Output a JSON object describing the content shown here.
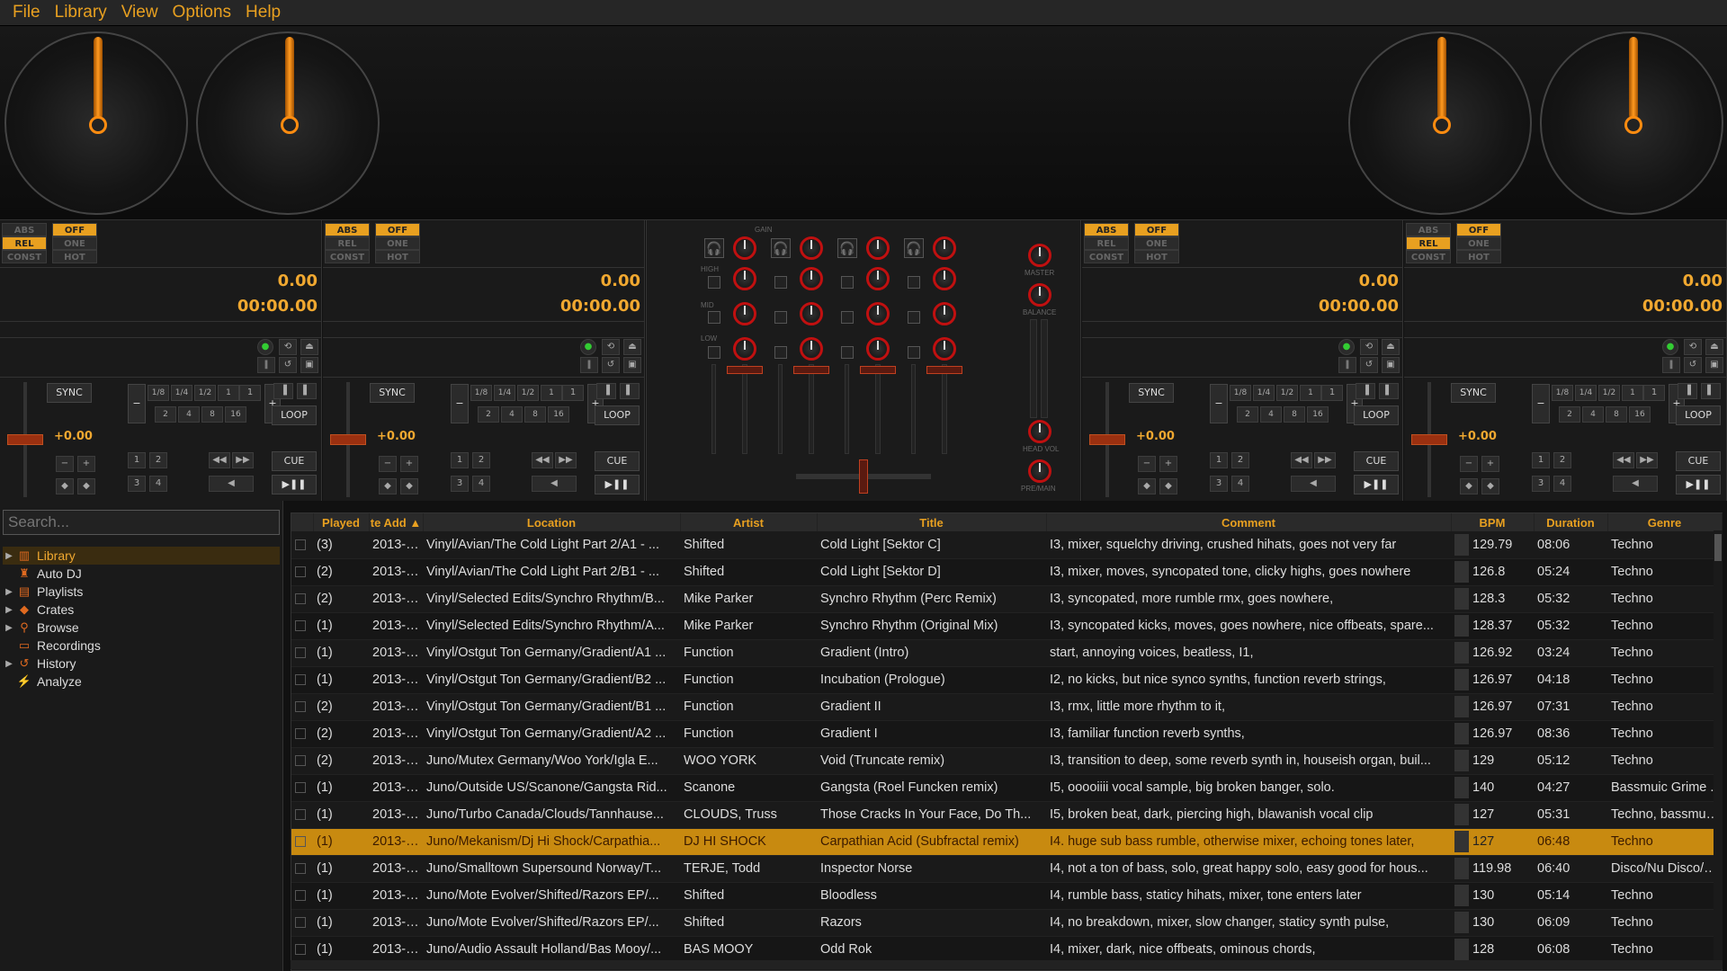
{
  "menu": {
    "file": "File",
    "library": "Library",
    "view": "View",
    "options": "Options",
    "help": "Help"
  },
  "colors": {
    "accent": "#e8a020",
    "selected_row": "#c88a10"
  },
  "decks": [
    {
      "mode_labels": [
        "ABS",
        "REL",
        "CONST"
      ],
      "cue_labels": [
        "OFF",
        "ONE",
        "HOT"
      ],
      "active_mode": "REL",
      "bpm": "0.00",
      "time": "00:00.00",
      "pitch": "+0.00",
      "sync": "SYNC",
      "loop": "LOOP",
      "cue": "CUE",
      "loop_sizes": [
        "1/8",
        "1/4",
        "1/2",
        "1",
        "2",
        "4",
        "8",
        "16"
      ],
      "hotcues": [
        "1",
        "2",
        "3",
        "4"
      ]
    },
    {
      "mode_labels": [
        "ABS",
        "REL",
        "CONST"
      ],
      "cue_labels": [
        "OFF",
        "ONE",
        "HOT"
      ],
      "active_mode": "ABS",
      "bpm": "0.00",
      "time": "00:00.00",
      "pitch": "+0.00",
      "sync": "SYNC",
      "loop": "LOOP",
      "cue": "CUE",
      "loop_sizes": [
        "1/8",
        "1/4",
        "1/2",
        "1",
        "2",
        "4",
        "8",
        "16"
      ],
      "hotcues": [
        "1",
        "2",
        "3",
        "4"
      ]
    },
    {
      "mode_labels": [
        "ABS",
        "REL",
        "CONST"
      ],
      "cue_labels": [
        "OFF",
        "ONE",
        "HOT"
      ],
      "active_mode": "ABS",
      "bpm": "0.00",
      "time": "00:00.00",
      "pitch": "+0.00",
      "sync": "SYNC",
      "loop": "LOOP",
      "cue": "CUE",
      "loop_sizes": [
        "1/8",
        "1/4",
        "1/2",
        "1",
        "2",
        "4",
        "8",
        "16"
      ],
      "hotcues": [
        "1",
        "2",
        "3",
        "4"
      ]
    },
    {
      "mode_labels": [
        "ABS",
        "REL",
        "CONST"
      ],
      "cue_labels": [
        "OFF",
        "ONE",
        "HOT"
      ],
      "active_mode": "REL",
      "bpm": "0.00",
      "time": "00:00.00",
      "pitch": "+0.00",
      "sync": "SYNC",
      "loop": "LOOP",
      "cue": "CUE",
      "loop_sizes": [
        "1/8",
        "1/4",
        "1/2",
        "1",
        "2",
        "4",
        "8",
        "16"
      ],
      "hotcues": [
        "1",
        "2",
        "3",
        "4"
      ]
    }
  ],
  "mixer": {
    "gain": "GAIN",
    "high": "HIGH",
    "mid": "MID",
    "low": "LOW",
    "master": "MASTER",
    "balance": "BALANCE",
    "head_vol": "HEAD VOL",
    "pre_main": "PRE/MAIN"
  },
  "sidebar": {
    "search_placeholder": "Search...",
    "items": [
      {
        "label": "Library",
        "icon": "library-icon",
        "arrow": "▶",
        "selected": true
      },
      {
        "label": "Auto DJ",
        "icon": "autodj-icon",
        "arrow": ""
      },
      {
        "label": "Playlists",
        "icon": "playlist-icon",
        "arrow": "▶"
      },
      {
        "label": "Crates",
        "icon": "crate-icon",
        "arrow": "▶"
      },
      {
        "label": "Browse",
        "icon": "search-icon",
        "arrow": "▶"
      },
      {
        "label": "Recordings",
        "icon": "recordings-icon",
        "arrow": ""
      },
      {
        "label": "History",
        "icon": "history-icon",
        "arrow": "▶"
      },
      {
        "label": "Analyze",
        "icon": "analyze-icon",
        "arrow": ""
      }
    ]
  },
  "table": {
    "columns": [
      "Played",
      "te Add ▲",
      "Location",
      "Artist",
      "Title",
      "Comment",
      "BPM",
      "Duration",
      "Genre"
    ],
    "rows": [
      [
        "(3)",
        "2013-0...",
        "Vinyl/Avian/The Cold Light Part 2/A1 - ...",
        "Shifted",
        "Cold Light [Sektor C]",
        "I3, mixer, squelchy driving, crushed hihats, goes not very far",
        "129.79",
        "08:06",
        "Techno"
      ],
      [
        "(2)",
        "2013-0...",
        "Vinyl/Avian/The Cold Light Part 2/B1 - ...",
        "Shifted",
        "Cold Light [Sektor D]",
        "I3, mixer, moves, syncopated tone, clicky highs, goes nowhere",
        "126.8",
        "05:24",
        "Techno"
      ],
      [
        "(2)",
        "2013-0...",
        "Vinyl/Selected Edits/Synchro Rhythm/B...",
        "Mike Parker",
        "Synchro Rhythm (Perc Remix)",
        "I3, syncopated, more rumble rmx, goes nowhere,",
        "128.3",
        "05:32",
        "Techno"
      ],
      [
        "(1)",
        "2013-0...",
        "Vinyl/Selected Edits/Synchro Rhythm/A...",
        "Mike Parker",
        "Synchro Rhythm (Original Mix)",
        "I3, syncopated kicks, moves, goes nowhere, nice offbeats, spare...",
        "128.37",
        "05:32",
        "Techno"
      ],
      [
        "(1)",
        "2013-0...",
        "Vinyl/Ostgut Ton Germany/Gradient/A1 ...",
        "Function",
        "Gradient (Intro)",
        "start, annoying voices, beatless, I1,",
        "126.92",
        "03:24",
        "Techno"
      ],
      [
        "(1)",
        "2013-0...",
        "Vinyl/Ostgut Ton Germany/Gradient/B2 ...",
        "Function",
        "Incubation (Prologue)",
        "I2, no kicks, but nice synco synths, function reverb strings,",
        "126.97",
        "04:18",
        "Techno"
      ],
      [
        "(2)",
        "2013-0...",
        "Vinyl/Ostgut Ton Germany/Gradient/B1 ...",
        "Function",
        "Gradient II",
        "I3, rmx, little more rhythm to it,",
        "126.97",
        "07:31",
        "Techno"
      ],
      [
        "(2)",
        "2013-0...",
        "Vinyl/Ostgut Ton Germany/Gradient/A2 ...",
        "Function",
        "Gradient I",
        "I3, familiar function reverb synths,",
        "126.97",
        "08:36",
        "Techno"
      ],
      [
        "(2)",
        "2013-0...",
        "Juno/Mutex Germany/Woo York/Igla E...",
        "WOO YORK",
        "Void (Truncate remix)",
        "I3, transition to deep, some reverb synth in, houseish organ, buil...",
        "129",
        "05:12",
        "Techno"
      ],
      [
        "(1)",
        "2013-0...",
        "Juno/Outside US/Scanone/Gangsta Rid...",
        "Scanone",
        "Gangsta (Roel Funcken remix)",
        "I5, ooooiiii vocal sample, big broken banger, solo.",
        "140",
        "04:27",
        "Bassmuic Grime ..."
      ],
      [
        "(1)",
        "2013-0...",
        "Juno/Turbo Canada/Clouds/Tannhause...",
        "CLOUDS, Truss",
        "Those Cracks In Your Face, Do Th...",
        "I5, broken beat, dark, piercing high, blawanish vocal clip",
        "127",
        "05:31",
        "Techno, bassmusic"
      ],
      [
        "(1)",
        "2013-0...",
        "Juno/Mekanism/Dj Hi Shock/Carpathia...",
        "DJ HI SHOCK",
        "Carpathian Acid (Subfractal remix)",
        "I4. huge sub bass rumble, otherwise mixer, echoing tones later,",
        "127",
        "06:48",
        "Techno"
      ],
      [
        "(1)",
        "2013-0...",
        "Juno/Smalltown Supersound Norway/T...",
        "TERJE, Todd",
        "Inspector Norse",
        "I4, not a ton of bass, solo, great happy solo, easy good for hous...",
        "119.98",
        "06:40",
        "Disco/Nu Disco/R..."
      ],
      [
        "(1)",
        "2013-0...",
        "Juno/Mote Evolver/Shifted/Razors EP/...",
        "Shifted",
        "Bloodless",
        "I4, rumble bass, staticy hihats, mixer, tone enters later",
        "130",
        "05:14",
        "Techno"
      ],
      [
        "(1)",
        "2013-0...",
        "Juno/Mote Evolver/Shifted/Razors EP/...",
        "Shifted",
        "Razors",
        "I4, no breakdown, mixer, slow changer, staticy synth pulse,",
        "130",
        "06:09",
        "Techno"
      ],
      [
        "(1)",
        "2013-0...",
        "Juno/Audio Assault Holland/Bas Mooy/...",
        "BAS MOOY",
        "Odd Rok",
        "I4, mixer, dark, nice offbeats, ominous chords,",
        "128",
        "06:08",
        "Techno"
      ]
    ],
    "selected_row": 11
  }
}
